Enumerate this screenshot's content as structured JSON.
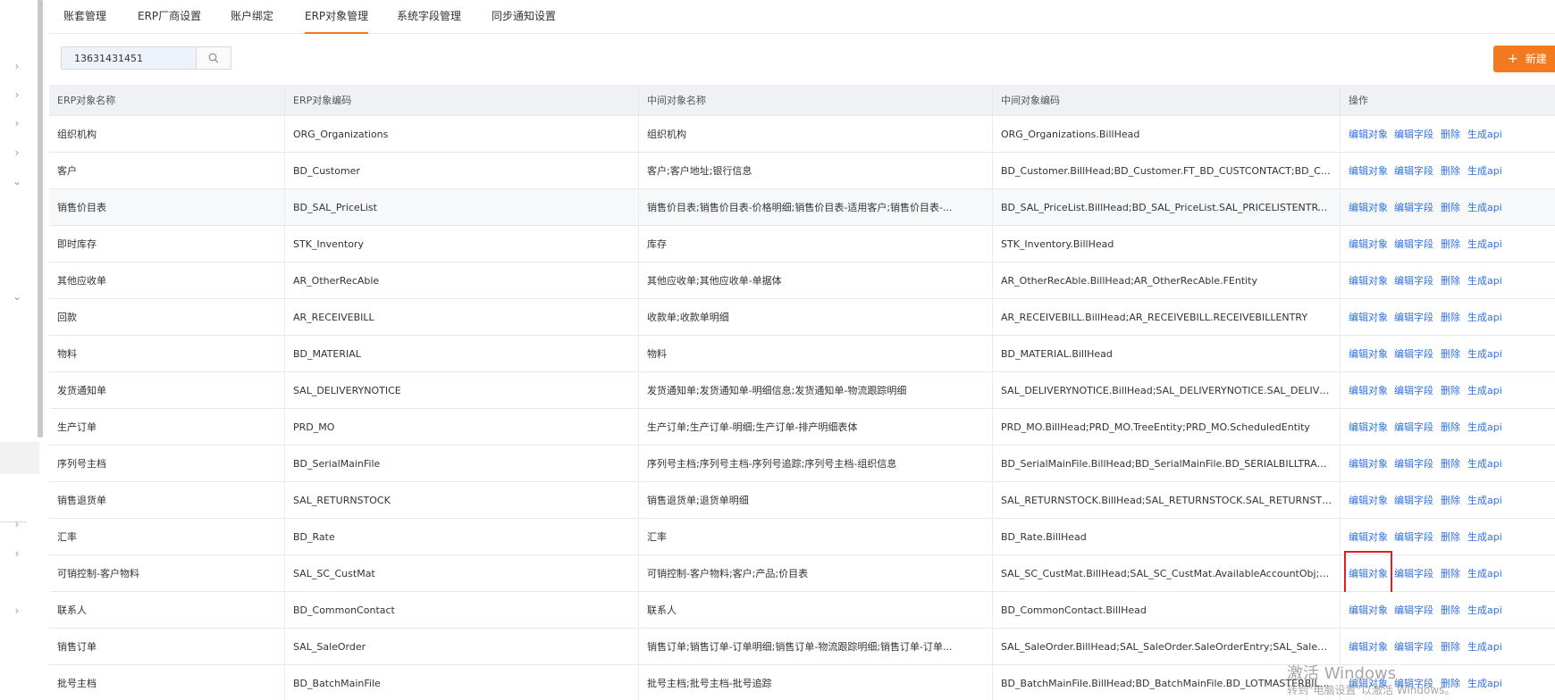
{
  "tabs": [
    {
      "label": "账套管理"
    },
    {
      "label": "ERP厂商设置"
    },
    {
      "label": "账户绑定"
    },
    {
      "label": "ERP对象管理"
    },
    {
      "label": "系统字段管理"
    },
    {
      "label": "同步通知设置"
    }
  ],
  "active_tab": "ERP对象管理",
  "search": {
    "value": "13631431451",
    "icon": "search-icon"
  },
  "new_button": {
    "label": "新建",
    "icon": "plus-icon"
  },
  "table": {
    "headers": [
      "ERP对象名称",
      "ERP对象编码",
      "中间对象名称",
      "中间对象编码",
      "操作"
    ],
    "actions": [
      "编辑对象",
      "编辑字段",
      "删除",
      "生成api"
    ],
    "rows": [
      [
        "组织机构",
        "ORG_Organizations",
        "组织机构",
        "ORG_Organizations.BillHead"
      ],
      [
        "客户",
        "BD_Customer",
        "客户;客户地址;银行信息",
        "BD_Customer.BillHead;BD_Customer.FT_BD_CUSTCONTACT;BD_Cust..."
      ],
      [
        "销售价目表",
        "BD_SAL_PriceList",
        "销售价目表;销售价目表-价格明细;销售价目表-适用客户;销售价目表-...",
        "BD_SAL_PriceList.BillHead;BD_SAL_PriceList.SAL_PRICELISTENTRY;B..."
      ],
      [
        "即时库存",
        "STK_Inventory",
        "库存",
        "STK_Inventory.BillHead"
      ],
      [
        "其他应收单",
        "AR_OtherRecAble",
        "其他应收单;其他应收单-单据体",
        "AR_OtherRecAble.BillHead;AR_OtherRecAble.FEntity"
      ],
      [
        "回款",
        "AR_RECEIVEBILL",
        "收款单;收款单明细",
        "AR_RECEIVEBILL.BillHead;AR_RECEIVEBILL.RECEIVEBILLENTRY"
      ],
      [
        "物料",
        "BD_MATERIAL",
        "物料",
        "BD_MATERIAL.BillHead"
      ],
      [
        "发货通知单",
        "SAL_DELIVERYNOTICE",
        "发货通知单;发货通知单-明细信息;发货通知单-物流跟踪明细",
        "SAL_DELIVERYNOTICE.BillHead;SAL_DELIVERYNOTICE.SAL_DELIVER..."
      ],
      [
        "生产订单",
        "PRD_MO",
        "生产订单;生产订单-明细;生产订单-排产明细表体",
        "PRD_MO.BillHead;PRD_MO.TreeEntity;PRD_MO.ScheduledEntity"
      ],
      [
        "序列号主档",
        "BD_SerialMainFile",
        "序列号主档;序列号主档-序列号追踪;序列号主档-组织信息",
        "BD_SerialMainFile.BillHead;BD_SerialMainFile.BD_SERIALBILLTRACE;B..."
      ],
      [
        "销售退货单",
        "SAL_RETURNSTOCK",
        "销售退货单;退货单明细",
        "SAL_RETURNSTOCK.BillHead;SAL_RETURNSTOCK.SAL_RETURNSTOC..."
      ],
      [
        "汇率",
        "BD_Rate",
        "汇率",
        "BD_Rate.BillHead"
      ],
      [
        "可销控制-客户物料",
        "SAL_SC_CustMat",
        "可销控制-客户物料;客户;产品;价目表",
        "SAL_SC_CustMat.BillHead;SAL_SC_CustMat.AvailableAccountObj;SAL_..."
      ],
      [
        "联系人",
        "BD_CommonContact",
        "联系人",
        "BD_CommonContact.BillHead"
      ],
      [
        "销售订单",
        "SAL_SaleOrder",
        "销售订单;销售订单-订单明细;销售订单-物流跟踪明细;销售订单-订单...",
        "SAL_SaleOrder.BillHead;SAL_SaleOrder.SaleOrderEntry;SAL_SaleOrde..."
      ],
      [
        "批号主档",
        "BD_BatchMainFile",
        "批号主档;批号主档-批号追踪",
        "BD_BatchMainFile.BillHead;BD_BatchMainFile.BD_LOTMASTERBILLTR..."
      ]
    ]
  },
  "watermark": {
    "title": "激活 Windows",
    "subtitle": "转到\"电脑设置\"以激活 Windows。"
  },
  "colors": {
    "accent": "#f5791f",
    "link": "#2f72e0",
    "highlight_box": "#e02020"
  }
}
